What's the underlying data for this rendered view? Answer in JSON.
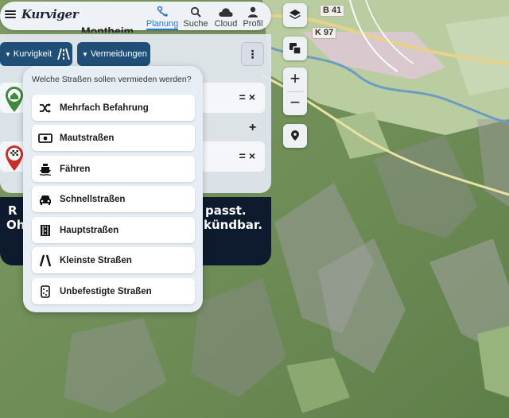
{
  "app": {
    "logo": "Kurviger"
  },
  "nav": {
    "items": [
      {
        "label": "Planung",
        "icon": "planning-icon",
        "active": true
      },
      {
        "label": "Suche",
        "icon": "search-icon"
      },
      {
        "label": "Cloud",
        "icon": "cloud-icon"
      },
      {
        "label": "Profil",
        "icon": "profile-icon"
      }
    ]
  },
  "panel": {
    "kurvigkeit_label": "Kurvigkeit",
    "vermeidungen_label": "Vermeidungen",
    "more_icon": "more-vertical-icon",
    "waypoint_controls": "=×",
    "add_symbol": "+",
    "clipped_top_text": "Montheim",
    "info_line1_left": "R",
    "info_line1_right": "passt.",
    "info_line2_left": "Oh",
    "info_line2_right": "kündbar."
  },
  "popup": {
    "title": "Welche Straßen sollen vermieden werden?",
    "options": [
      {
        "label": "Mehrfach Befahrung",
        "icon": "shuffle-icon"
      },
      {
        "label": "Mautstraßen",
        "icon": "toll-money-icon"
      },
      {
        "label": "Fähren",
        "icon": "ferry-icon"
      },
      {
        "label": "Schnellstraßen",
        "icon": "car-icon"
      },
      {
        "label": "Hauptstraßen",
        "icon": "main-road-icon"
      },
      {
        "label": "Kleinste Straßen",
        "icon": "narrow-road-icon"
      },
      {
        "label": "Unbefestigte Straßen",
        "icon": "unpaved-road-icon"
      }
    ]
  },
  "map": {
    "labels": [
      "B 41",
      "K 97"
    ],
    "controls": {
      "zoom_in": "+",
      "zoom_out": "−"
    }
  },
  "colors": {
    "accent": "#2b78c5",
    "dark_button": "#1f4e77",
    "info_bg": "#0e1a2d",
    "home_pin": "#3d8a3a",
    "finish_pin": "#c9302c"
  }
}
